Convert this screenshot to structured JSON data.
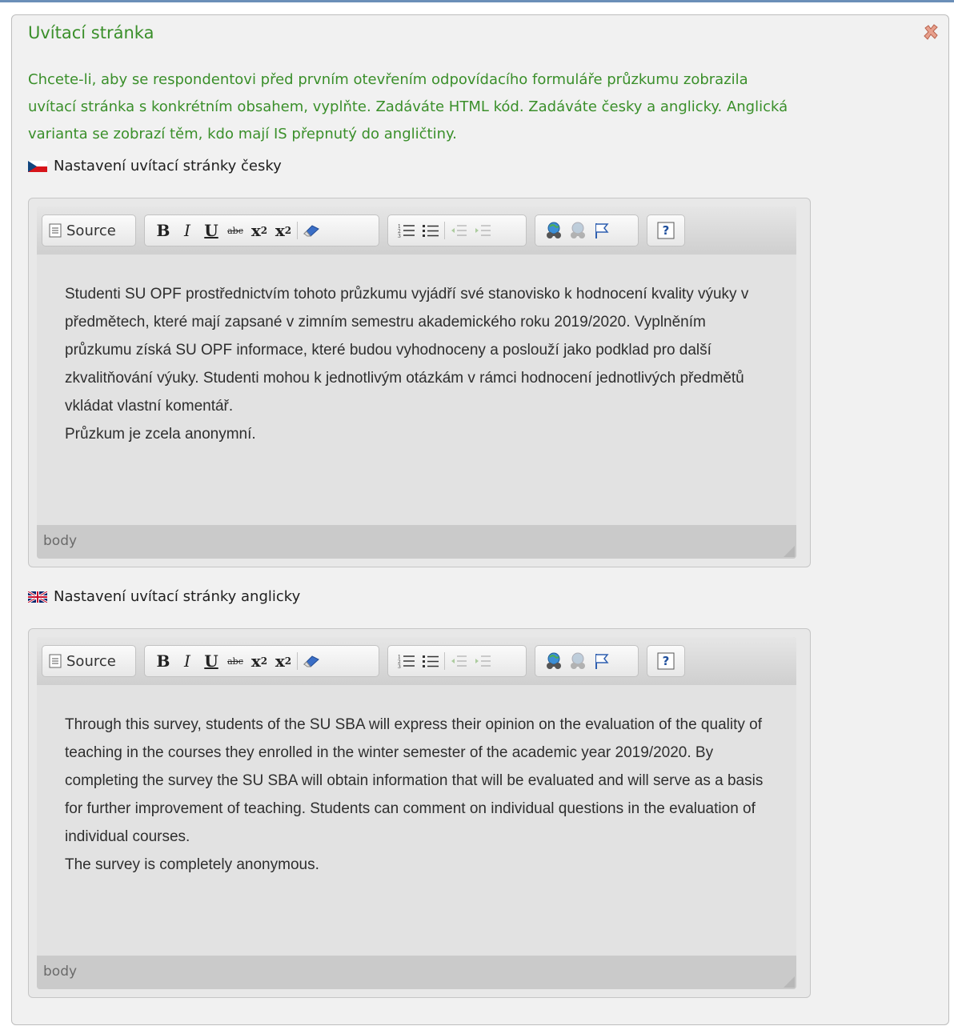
{
  "panel": {
    "title": "Uvítací stránka",
    "intro": "Chcete-li, aby se respondentovi před prvním otevřením odpovídacího formuláře průzkumu zobrazila uvítací stránka s konkrétním obsahem, vyplňte. Zadáváte HTML kód. Zadáváte česky a anglicky. Anglická varianta se zobrazí těm, kdo mají IS přepnutý do angličtiny.",
    "close_icon": "close-icon"
  },
  "colors": {
    "title": "#3a8f2a",
    "panel_background": "#f1f1f1",
    "editor_content": "#e2e2e2"
  },
  "toolbar": {
    "source_label": "Source",
    "bold": "B",
    "italic": "I",
    "underline": "U",
    "strike": "abc",
    "subscript": "x",
    "superscript": "x",
    "icons": [
      "source-icon",
      "remove-format-icon",
      "numbered-list-icon",
      "bulleted-list-icon",
      "outdent-icon",
      "indent-icon",
      "link-icon",
      "unlink-icon",
      "anchor-icon",
      "help-icon"
    ]
  },
  "editors": {
    "czech": {
      "label": "Nastavení uvítací stránky česky",
      "flag": "czech-flag-icon",
      "paragraphs": [
        "Studenti SU OPF prostřednictvím tohoto průzkumu vyjádří své stanovisko k hodnocení kvality výuky v předmětech, které mají zapsané v zimním semestru akademického roku 2019/2020. Vyplněním průzkumu získá SU OPF informace, které budou vyhodnoceny a poslouží jako podklad pro další zkvalitňování výuky. Studenti mohou k jednotlivým otázkám v rámci hodnocení jednotlivých předmětů vkládat vlastní komentář.",
        "Průzkum je zcela anonymní."
      ],
      "status_path": "body"
    },
    "english": {
      "label": "Nastavení uvítací stránky anglicky",
      "flag": "uk-flag-icon",
      "paragraphs": [
        "Through this survey, students of the SU SBA will express their opinion on the evaluation of the quality of teaching in the courses they enrolled in the winter semester of the academic year 2019/2020. By completing the survey the SU SBA will obtain information that will be evaluated and will serve as a basis for further improvement of teaching. Students can comment on individual questions in the evaluation of individual courses.",
        "The survey is completely anonymous."
      ],
      "status_path": "body"
    }
  }
}
